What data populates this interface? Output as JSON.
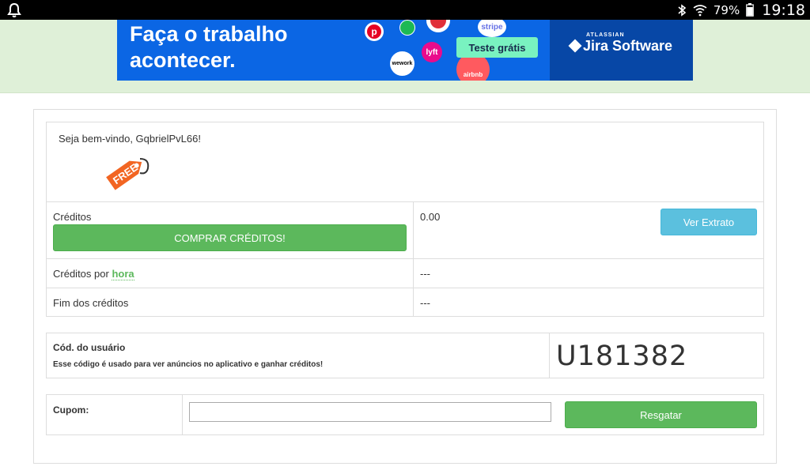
{
  "status_bar": {
    "battery_percent": "79%",
    "time": "19:18",
    "icons": [
      "notification-bell-icon",
      "bluetooth-icon",
      "wifi-icon",
      "battery-icon"
    ]
  },
  "ad": {
    "headline": "Faça o trabalho acontecer.",
    "cta": "Teste grátis",
    "brand_small": "ATLASSIAN",
    "brand": "Jira Software",
    "logos": [
      "pinterest",
      "spotify",
      "wework",
      "lyft",
      "stripe",
      "airbnb"
    ],
    "logo_labels": {
      "stripe": "stripe",
      "wework": "wework",
      "lyft": "lyft",
      "airbnb": "airbnb"
    },
    "colors": {
      "background": "#0b66e4",
      "cta": "#79f2c0",
      "brand_panel": "#0747a6"
    }
  },
  "welcome": {
    "message": "Seja bem-vindo, GqbrielPvL66!",
    "badge": "FREE"
  },
  "credits": {
    "label": "Créditos",
    "buy_button": "COMPRAR CRÉDITOS!",
    "value": "0.00",
    "statement_button": "Ver Extrato",
    "per_hour_label": "Créditos por",
    "per_hour_link": "hora",
    "per_hour_value": "---",
    "end_label": "Fim dos créditos",
    "end_value": "---"
  },
  "user_code": {
    "title": "Cód. do usuário",
    "description": "Esse código é usado para ver anúncios no aplicativo e ganhar créditos!",
    "code": "U181382"
  },
  "coupon": {
    "label": "Cupom:",
    "input_value": "",
    "button": "Resgatar"
  },
  "colors": {
    "green": "#5cb85c",
    "blue": "#5bc0de",
    "band": "#dff0d8"
  }
}
